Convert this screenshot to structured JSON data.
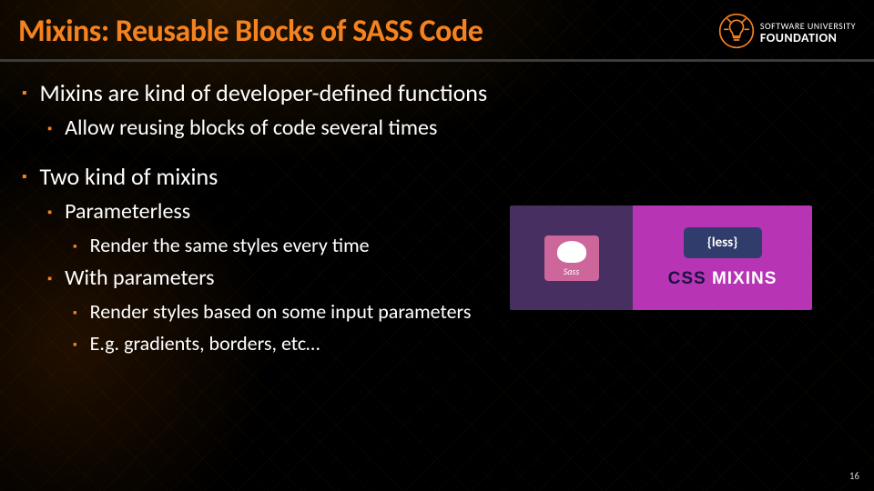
{
  "title": "Mixins: Reusable Blocks of SASS Code",
  "logo": {
    "line1": "SOFTWARE UNIVERSITY",
    "line2": "FOUNDATION"
  },
  "bullets": {
    "b1": "Mixins are kind of developer-defined functions",
    "b1a": "Allow reusing blocks of code several times",
    "b2": "Two kind of mixins",
    "b2a": "Parameterless",
    "b2a1": "Render the same styles every time",
    "b2b": "With parameters",
    "b2b1": "Render styles based on some input parameters",
    "b2b2": "E.g. gradients, borders, etc…"
  },
  "illustration": {
    "sass_label": "Sass",
    "less_label": "{less}",
    "caption_css": "CSS",
    "caption_mixins": "MIXINS"
  },
  "page_number": "16"
}
